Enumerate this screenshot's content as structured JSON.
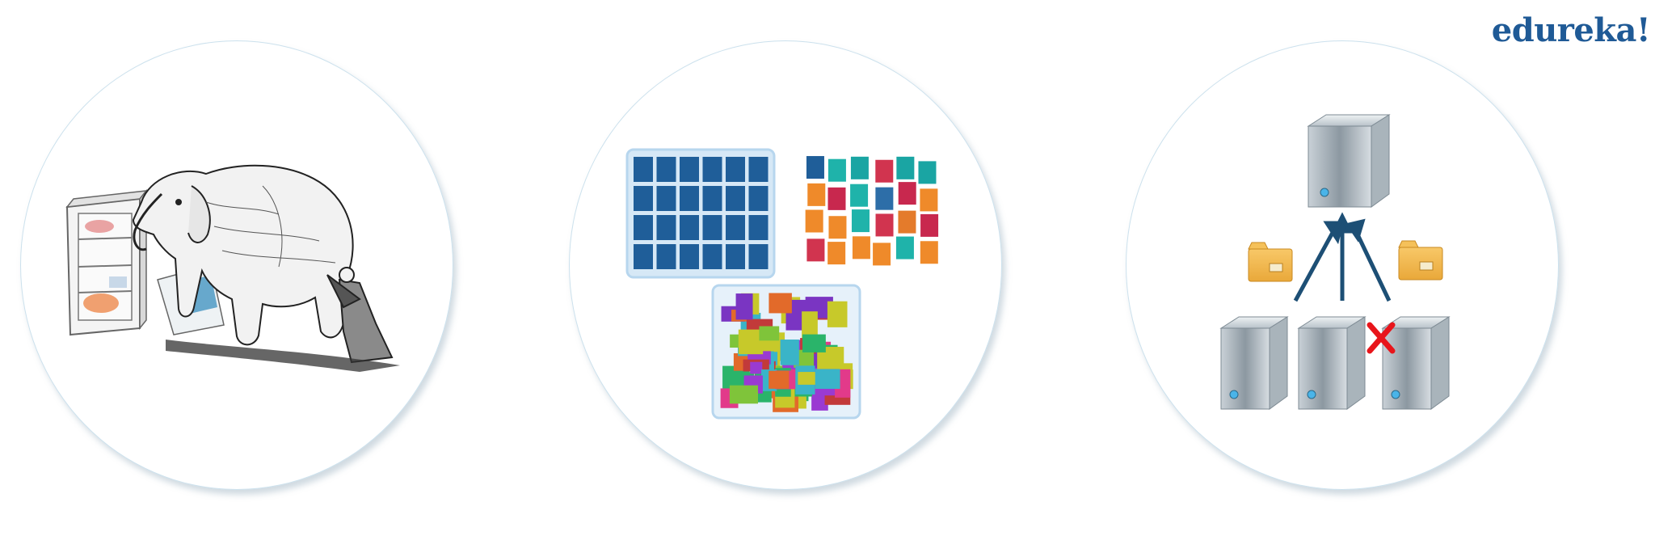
{
  "logo": {
    "text": "edureka!",
    "color": "#1f5a96"
  },
  "panels": [
    {
      "name": "elephant-in-fridge",
      "description_icon": "elephant-fridge-illustration"
    },
    {
      "name": "structured-vs-unstructured-data",
      "description_icon": "data-blocks-illustration"
    },
    {
      "name": "distributed-servers",
      "description_icon": "server-cluster-illustration"
    }
  ],
  "colors": {
    "circle_border": "#a8cde0",
    "grid_blue": "#1f5e99",
    "grid_frame": "#b7d6ee",
    "server_grey": "#8e9aa3",
    "arrow": "#1d4f75",
    "folder": "#f3b54c",
    "cross": "#e8151b"
  }
}
